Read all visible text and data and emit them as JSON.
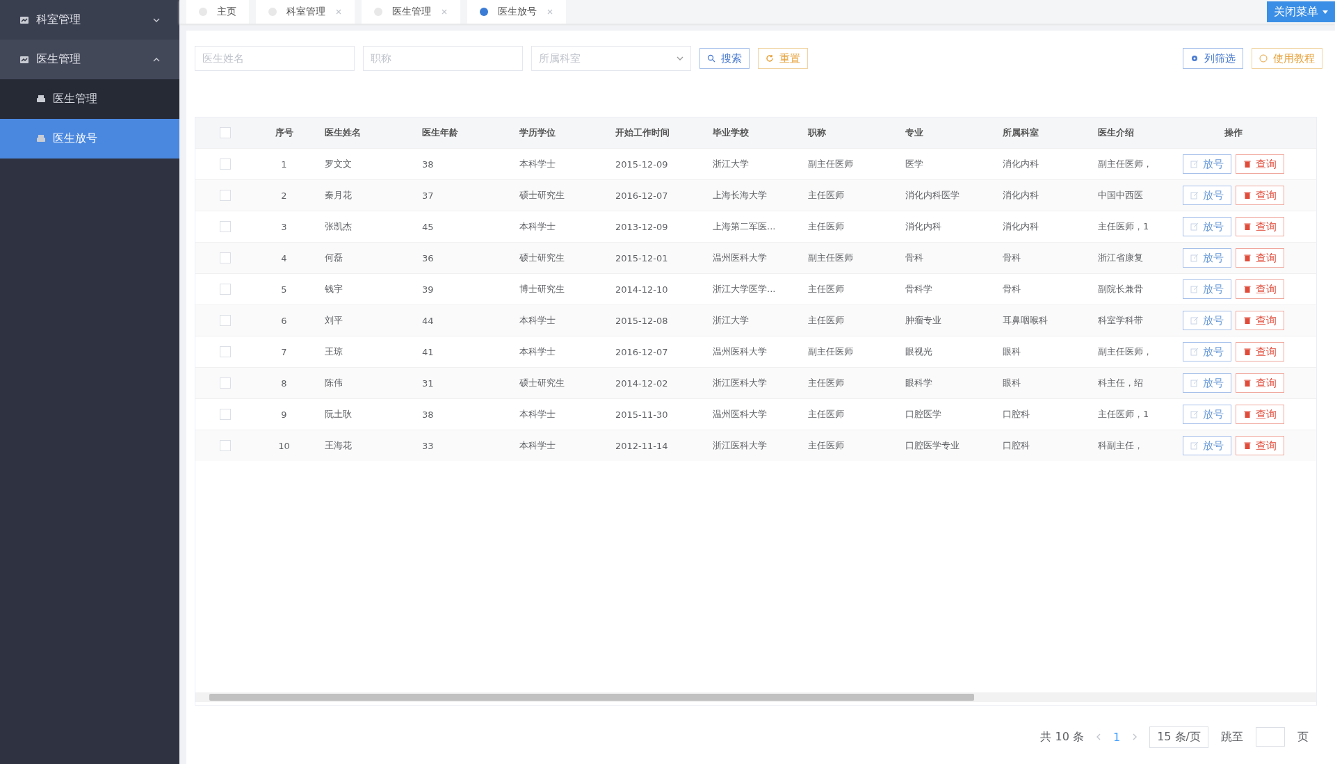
{
  "sidebar": {
    "items": [
      {
        "label": "科室管理",
        "expanded": false
      },
      {
        "label": "医生管理",
        "expanded": true,
        "children": [
          {
            "label": "医生管理",
            "selected": false
          },
          {
            "label": "医生放号",
            "selected": true
          }
        ]
      }
    ]
  },
  "tabs": [
    {
      "label": "主页",
      "selected": false,
      "closable": false
    },
    {
      "label": "科室管理",
      "selected": false,
      "closable": true
    },
    {
      "label": "医生管理",
      "selected": false,
      "closable": true
    },
    {
      "label": "医生放号",
      "selected": true,
      "closable": true
    }
  ],
  "close_menu_button": "关闭菜单",
  "filters": {
    "name": {
      "placeholder": "医生姓名"
    },
    "title": {
      "placeholder": "职称"
    },
    "department": {
      "placeholder": "所属科室"
    }
  },
  "buttons": {
    "search": "搜索",
    "reset": "重置",
    "columns": "列筛选",
    "tutorial": "使用教程"
  },
  "table": {
    "all_checked": false,
    "columns": [
      "序号",
      "医生姓名",
      "医生年龄",
      "学历学位",
      "开始工作时间",
      "毕业学校",
      "职称",
      "专业",
      "所属科室",
      "医生介绍",
      "操作"
    ],
    "rows": [
      {
        "checked": false,
        "cells": [
          "1",
          "罗文文",
          "38",
          "本科学士",
          "2015-12-09",
          "浙江大学",
          "副主任医师",
          "医学",
          "消化内科",
          "副主任医师，"
        ],
        "actions": [
          "放号",
          "查询"
        ]
      },
      {
        "checked": false,
        "cells": [
          "2",
          "秦月花",
          "37",
          "硕士研究生",
          "2016-12-07",
          "上海长海大学",
          "主任医师",
          "消化内科医学",
          "消化内科",
          "中国中西医"
        ],
        "actions": [
          "放号",
          "查询"
        ]
      },
      {
        "checked": false,
        "cells": [
          "3",
          "张凯杰",
          "45",
          "本科学士",
          "2013-12-09",
          "上海第二军医...",
          "主任医师",
          "消化内科",
          "消化内科",
          "主任医师，1"
        ],
        "actions": [
          "放号",
          "查询"
        ]
      },
      {
        "checked": false,
        "cells": [
          "4",
          "何磊",
          "36",
          "硕士研究生",
          "2015-12-01",
          "温州医科大学",
          "副主任医师",
          "骨科",
          "骨科",
          "浙江省康复"
        ],
        "actions": [
          "放号",
          "查询"
        ]
      },
      {
        "checked": false,
        "cells": [
          "5",
          "钱宇",
          "39",
          "博士研究生",
          "2014-12-10",
          "浙江大学医学...",
          "主任医师",
          "骨科学",
          "骨科",
          "副院长兼骨"
        ],
        "actions": [
          "放号",
          "查询"
        ]
      },
      {
        "checked": false,
        "cells": [
          "6",
          "刘平",
          "44",
          "本科学士",
          "2015-12-08",
          "浙江大学",
          "主任医师",
          "肿瘤专业",
          "耳鼻咽喉科",
          "科室学科带"
        ],
        "actions": [
          "放号",
          "查询"
        ]
      },
      {
        "checked": false,
        "cells": [
          "7",
          "王琼",
          "41",
          "本科学士",
          "2016-12-07",
          "温州医科大学",
          "副主任医师",
          "眼视光",
          "眼科",
          "副主任医师，"
        ],
        "actions": [
          "放号",
          "查询"
        ]
      },
      {
        "checked": false,
        "cells": [
          "8",
          "陈伟",
          "31",
          "硕士研究生",
          "2014-12-02",
          "浙江医科大学",
          "主任医师",
          "眼科学",
          "眼科",
          "科主任，绍"
        ],
        "actions": [
          "放号",
          "查询"
        ]
      },
      {
        "checked": false,
        "cells": [
          "9",
          "阮土耿",
          "38",
          "本科学士",
          "2015-11-30",
          "温州医科大学",
          "主任医师",
          "口腔医学",
          "口腔科",
          "主任医师，1"
        ],
        "actions": [
          "放号",
          "查询"
        ]
      },
      {
        "checked": false,
        "cells": [
          "10",
          "王海花",
          "33",
          "本科学士",
          "2012-11-14",
          "浙江医科大学",
          "主任医师",
          "口腔医学专业",
          "口腔科",
          "科副主任，"
        ],
        "actions": [
          "放号",
          "查询"
        ]
      }
    ]
  },
  "pagination": {
    "total": "共 10 条",
    "pages": [
      {
        "label": "1",
        "selected": true
      }
    ],
    "page_size": "15 条/页",
    "jump_label": "跳至",
    "page_suffix": "页"
  }
}
